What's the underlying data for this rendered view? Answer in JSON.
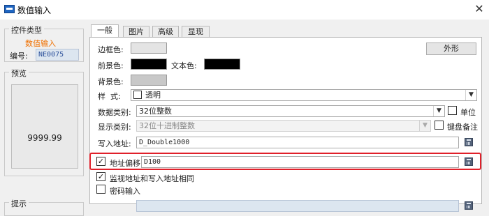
{
  "window": {
    "title": "数值输入",
    "close_glyph": "✕"
  },
  "control_type": {
    "legend": "控件类型",
    "type_name": "数值输入",
    "id_label": "编号:",
    "id_value": "NE0075"
  },
  "preview": {
    "legend": "预览",
    "value": "9999.99"
  },
  "bottom_left": {
    "legend": "提示"
  },
  "tabs": [
    {
      "label": "一般",
      "active": true
    },
    {
      "label": "图片",
      "active": false
    },
    {
      "label": "高级",
      "active": false
    },
    {
      "label": "显现",
      "active": false
    }
  ],
  "general": {
    "border_color_label": "边框色:",
    "shape_button": "外形",
    "fore_color_label": "前景色:",
    "text_color_label": "文本色:",
    "back_color_label": "背景色:",
    "style_label": "样  式:",
    "style_value": "透明",
    "data_type_label": "数据类别:",
    "data_type_value": "32位整数",
    "unit_label": "单位",
    "display_type_label": "显示类别:",
    "display_type_value": "32位十进制整数",
    "keyboard_note_label": "键盘备注",
    "write_addr_label": "写入地址:",
    "write_addr_value": "D_Double1000",
    "addr_offset_label": "地址偏移",
    "addr_offset_value": "D100",
    "addr_offset_checked": true,
    "monitor_same_label": "监视地址和写入地址相同",
    "monitor_same_checked": true,
    "password_label": "密码输入",
    "password_checked": false
  },
  "colors": {
    "border_swatch": "#e4e4e4",
    "fore_swatch": "#000000",
    "text_swatch": "#000000",
    "back_swatch": "#c8c8c8",
    "highlight": "#e0202a",
    "accent_orange": "#f07000"
  }
}
